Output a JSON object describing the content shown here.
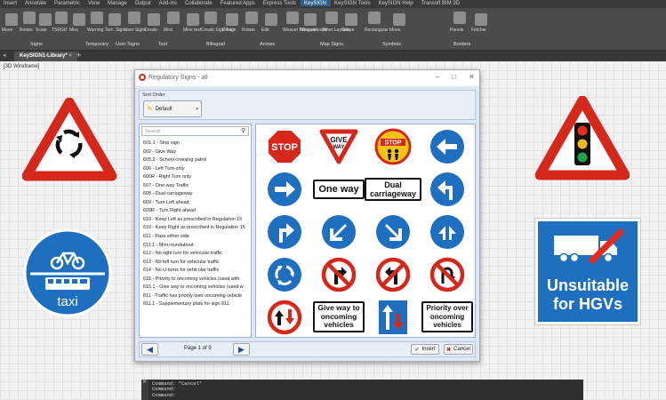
{
  "menubar": [
    "Insert",
    "Annotate",
    "Parametric",
    "View",
    "Manage",
    "Output",
    "Add-ins",
    "Collaborate",
    "Featured Apps",
    "Express Tools",
    "KeySIGN",
    "KeySIGN Tools",
    "KeySIGN Help",
    "Transoft BIM 3D"
  ],
  "ribbon": {
    "items": [
      "Move",
      "Rotate",
      "Scale",
      "TSRGD",
      "Misc",
      "Warning",
      "Tem. Signs",
      "User Signs",
      "Create",
      "Med",
      "Mine text",
      "Create Sign Text",
      "Design",
      "Rotate",
      "Edit",
      "Weaver Bilingual",
      "Roundabouts",
      "Other Layouts",
      "Shape",
      "Rectangular",
      "Move",
      "Panels",
      "Fetcher"
    ],
    "groups": [
      "Signs",
      "Temporary",
      "User Signs",
      "Text",
      "Bilingual",
      "Arrows",
      "Map Signs",
      "Symbols",
      "Borders"
    ]
  },
  "tabs": {
    "doc": "KeySIGN1-Library*",
    "close": "×",
    "add": "+"
  },
  "viewport_label": "[3D Wireframe]",
  "dialog": {
    "title": "Regulatory Signs - all",
    "sort_label": "Sort Order",
    "sort_value": "Default",
    "search_placeholder": "Search",
    "items": [
      "601.1 - Stop sign",
      "602 - Give Way",
      "605.2 - School crossing patrol",
      "606 - Left Turn only",
      "606R - Right Turn only",
      "607 - One-way Traffic",
      "608 - Dual carriageway",
      "609 - Turn Left ahead",
      "609R - Turn Right ahead",
      "610 - Keep Left as prescribed in Regulation 15",
      "610 - Keep Right as prescribed in Regulation 15",
      "611 - Pass either side",
      "611.1 - Mini roundabout",
      "612 - No right turn for vehicular traffic",
      "613 - No left turn for vehicular traffic",
      "614 - No U-turns for vehicular traffic",
      "615 - Priority to oncoming vehicles (used with",
      "615.1 - Give way to oncoming vehicles (used w",
      "811 - Traffic has priority over oncoming vehicle",
      "811.1 - Supplementary plate for sign 811"
    ],
    "sign_text": {
      "stop": "STOP",
      "give1": "GIVE",
      "give2": "WAY",
      "stop_child": "STOP",
      "oneway": "One way",
      "dual1": "Dual",
      "dual2": "carriageway",
      "gw1": "Give way to",
      "gw2": "oncoming",
      "gw3": "vehicles",
      "pr1": "Priority over",
      "pr2": "oncoming",
      "pr3": "vehicles"
    },
    "page": "Page 1 of 9",
    "insert": "Insert",
    "cancel": "Cancel"
  },
  "hgv": {
    "line1": "Unsuitable",
    "line2": "for HGVs"
  },
  "bus_sign": {
    "taxi": "taxi"
  },
  "command": [
    "Command: *Cancel*",
    "Command:",
    "Command:"
  ],
  "colors": {
    "red": "#d5281b",
    "blue": "#1f6fc1"
  }
}
